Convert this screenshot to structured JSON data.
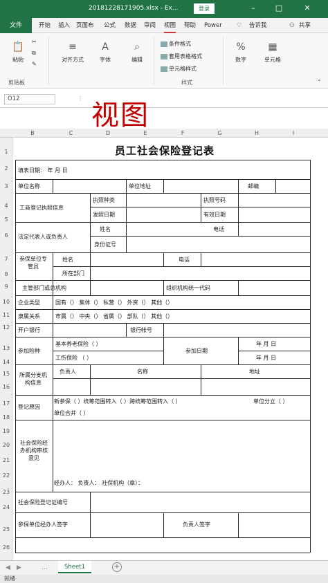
{
  "window": {
    "title": "20181228171905.xlsx - Ex...",
    "login_label": "登录",
    "minimize": "–",
    "restore": "□",
    "close": "✕"
  },
  "tabs": {
    "file": "文件",
    "items": [
      "开始",
      "插入",
      "页面布",
      "公式",
      "数据",
      "审阅",
      "视图",
      "帮助",
      "Power",
      "告诉我",
      "共享"
    ],
    "selected": "视图"
  },
  "ribbon": {
    "paste": "粘贴",
    "clipboard": "剪贴板",
    "align": "对齐方式",
    "font": "字体",
    "edit": "编辑",
    "cond_format": "条件格式",
    "table_format": "套用表格格式",
    "cell_style": "单元格样式",
    "styles": "样式",
    "number": "数字",
    "cells": "单元格"
  },
  "formula_bar": {
    "name_box": "O12",
    "overlay_text": "视图"
  },
  "columns": [
    "B",
    "C",
    "D",
    "E",
    "F",
    "G",
    "H",
    "I"
  ],
  "rows": [
    "1",
    "2",
    "3",
    "4",
    "5",
    "6",
    "7",
    "8",
    "9",
    "10",
    "11",
    "12",
    "13",
    "14",
    "15",
    "16",
    "17",
    "18",
    "19",
    "20",
    "21",
    "22",
    "23",
    "24",
    "25",
    "26"
  ],
  "form": {
    "title": "员工社会保险登记表",
    "fill_date": "填表日期：  年   月   日",
    "unit_name": "单位名称",
    "unit_addr": "单位地址",
    "postcode": "邮编",
    "biz_reg": "工商登记执照信息",
    "license_type": "执照种类",
    "license_no": "执照号码",
    "issue_date": "发照日期",
    "valid_period": "有效日期",
    "legal_rep": "法定代表人或负责人",
    "name": "姓名",
    "phone": "电话",
    "id_no": "身份证号",
    "ins_staff": "参保单位专管员",
    "staff_name": "姓名",
    "staff_phone": "电话",
    "dept": "所在部门",
    "authority": "主管部门或总机构",
    "org_code": "组织机构统一代码",
    "ent_type": "企业类型",
    "ent_type_opts": "国有（）  集体（）  私营（）  外资（）  其他（）",
    "affil": "隶属关系",
    "affil_opts": "市属（）  中央（）  省属（）  部队（）  其他（）",
    "bank": "开户银行",
    "account": "银行帐号",
    "insurance": "参加险种",
    "pension": "基本养老保险（  ）",
    "injury": "工伤保险  （  ）",
    "join_date": "参加日期",
    "ymd1": "年  月  日",
    "ymd2": "年  月  日",
    "branch": "所属分支机构信息",
    "manager": "负责人",
    "branch_name": "名称",
    "address": "地址",
    "reason": "登记原因",
    "reason_opts1": "新参保（  ）统筹范围转入（  ）跨统筹范围转入（  ）",
    "reason_opts2": "单位分立（  ）",
    "reason_opts3": "单位合并（  ）",
    "review": "社会保险经办机构审核意见",
    "handler_line": "经办人：    负责人：    社保机构（章）：",
    "reg_no": "社会保险登记证编号",
    "sign": "参保单位经办人签字",
    "manager_sign": "负责人签字"
  },
  "footer": {
    "sheet": "Sheet1",
    "status": "就绪"
  }
}
